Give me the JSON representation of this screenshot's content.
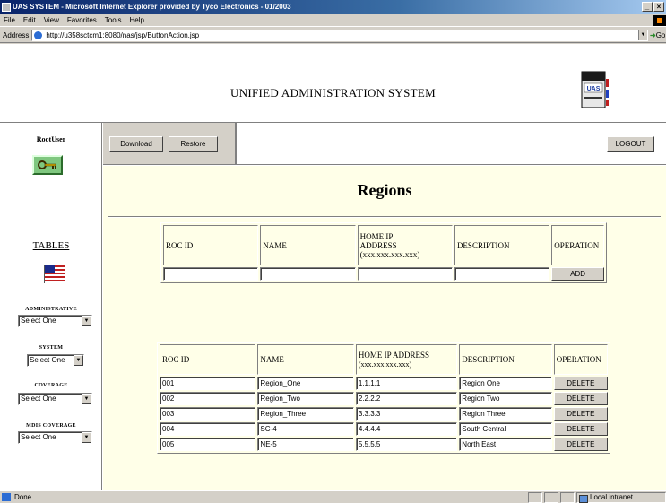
{
  "window": {
    "title": "UAS SYSTEM - Microsoft Internet Explorer provided by Tyco Electronics - 01/2003",
    "buttons": [
      "_",
      "×"
    ]
  },
  "menu": [
    "File",
    "Edit",
    "View",
    "Favorites",
    "Tools",
    "Help"
  ],
  "address": {
    "label": "Address",
    "url": "http://u358sctcm1:8080/nas/jsp/ButtonAction.jsp",
    "go_label": "Go"
  },
  "header": {
    "title": "UNIFIED ADMINISTRATION SYSTEM",
    "logo_text": "UAS"
  },
  "sidebar": {
    "user": "RootUser",
    "tables_link": "TABLES",
    "administrative_label": "ADMINISTRATIVE",
    "administrative_value": "Select One",
    "system_label": "SYSTEM",
    "system_value": "Select One",
    "coverage_label": "COVERAGE",
    "coverage_value": "Select One",
    "mdis_label": "MDIS COVERAGE",
    "mdis_value": "Select One"
  },
  "toolbar": {
    "download": "Download",
    "restore": "Restore",
    "logout": "LOGOUT"
  },
  "content": {
    "title": "Regions",
    "add_form": {
      "headers": [
        "ROC ID",
        "NAME",
        "HOME IP ADDRESS (xxx.xxx.xxx.xxx)",
        "DESCRIPTION",
        "OPERATION"
      ],
      "header_home_ip_line1": "HOME IP",
      "header_home_ip_line2": "ADDRESS",
      "header_home_ip_line3": "(xxx.xxx.xxx.xxx)",
      "add_label": "ADD"
    },
    "list": {
      "headers": {
        "roc_id": "ROC ID",
        "name": "NAME",
        "home_ip_line1": "HOME IP ADDRESS",
        "home_ip_line2": "(xxx.xxx.xxx.xxx)",
        "description": "DESCRIPTION",
        "operation": "OPERATION"
      },
      "delete_label": "DELETE",
      "rows": [
        {
          "roc_id": "001",
          "name": "Region_One",
          "ip": "1.1.1.1",
          "description": "Region One"
        },
        {
          "roc_id": "002",
          "name": "Region_Two",
          "ip": "2.2.2.2",
          "description": "Region Two"
        },
        {
          "roc_id": "003",
          "name": "Region_Three",
          "ip": "3.3.3.3",
          "description": "Region Three"
        },
        {
          "roc_id": "004",
          "name": "SC-4",
          "ip": "4.4.4.4",
          "description": "South Central"
        },
        {
          "roc_id": "005",
          "name": "NE-5",
          "ip": "5.5.5.5",
          "description": "North East"
        }
      ]
    }
  },
  "status": {
    "text": "Done",
    "zone": "Local intranet"
  },
  "colors": {
    "content_bg": "#ffffe8",
    "chrome": "#d4d0c8",
    "titlebar": "#0a246a"
  }
}
